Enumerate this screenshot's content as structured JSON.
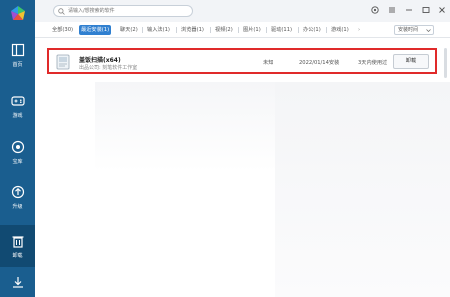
{
  "app": {
    "colors": {
      "sidebar": "#1a5e8f",
      "sidebar_active": "#114a72",
      "accent": "#2f7fd0",
      "highlight_border": "#e02a2a"
    }
  },
  "sidebar": {
    "items": [
      {
        "label": "首页",
        "icon": "home-icon"
      },
      {
        "label": "游戏",
        "icon": "gamepad-icon"
      },
      {
        "label": "宝库",
        "icon": "treasure-icon"
      },
      {
        "label": "升级",
        "icon": "upgrade-icon"
      },
      {
        "label": "卸载",
        "icon": "trash-icon"
      }
    ],
    "bottom_icon": "download-icon"
  },
  "search": {
    "placeholder": "请输入/想搜索的软件"
  },
  "filters": {
    "tabs": [
      "全部(30)",
      "最近安装(1)",
      "聊天(2)",
      "输入法(1)",
      "浏览器(1)",
      "视频(2)",
      "图片(1)",
      "驱动(11)",
      "办公(1)",
      "游戏(1)"
    ],
    "active_index": 1,
    "sort_label": "安装时间"
  },
  "apps": [
    {
      "name": "盖饭扫描(x64)",
      "publisher": "出品公司: 刻笔软件工作室",
      "size": "未知",
      "install_date": "2022/01/14安装",
      "last_used": "3天内使用过",
      "action": "卸载"
    }
  ]
}
